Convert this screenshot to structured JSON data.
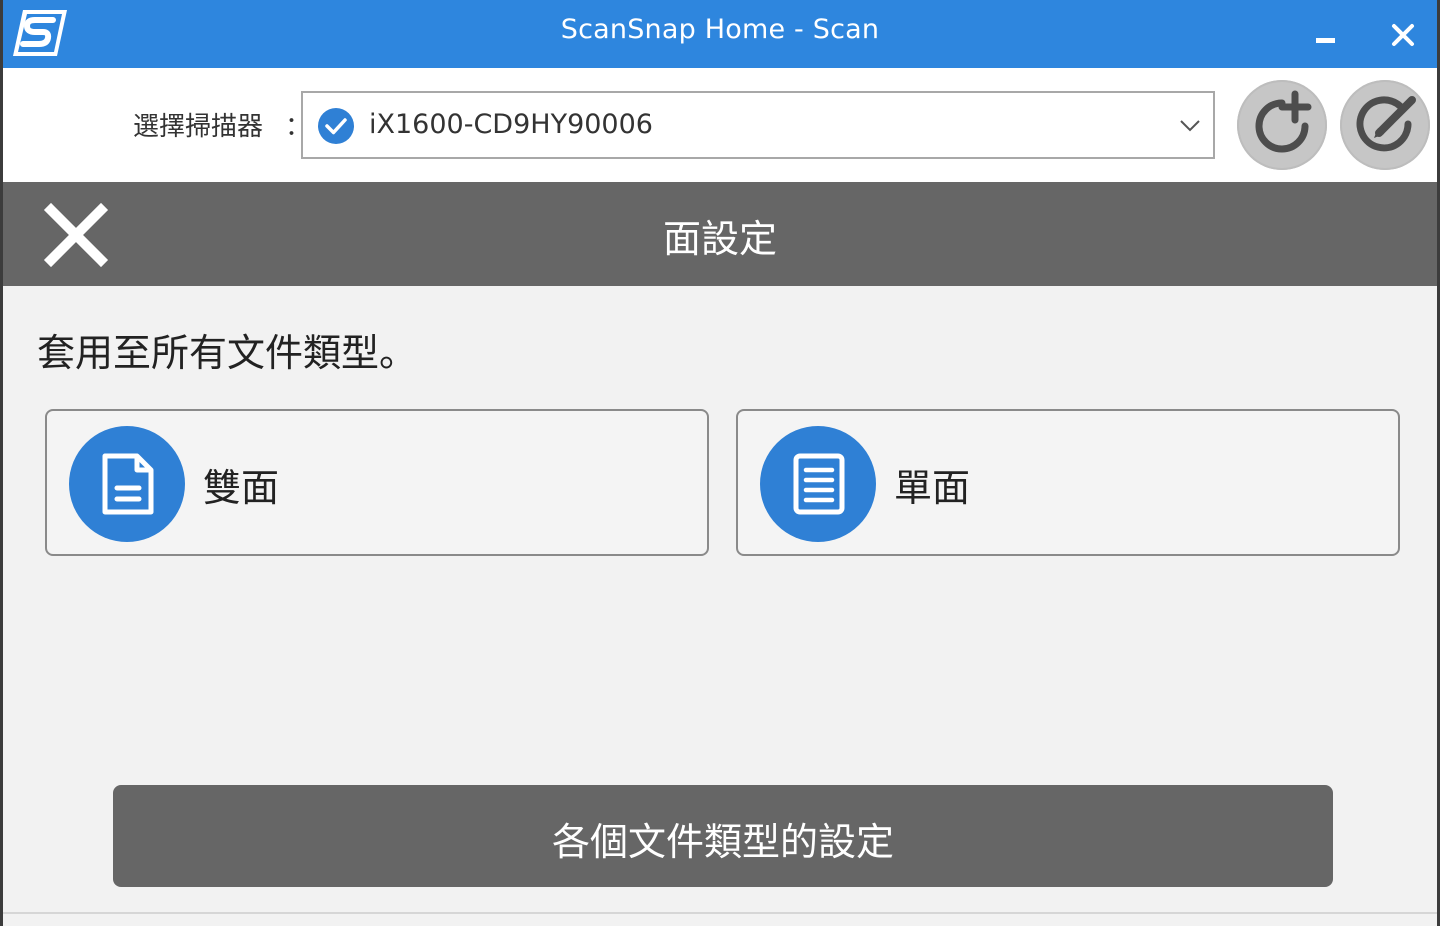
{
  "window": {
    "title": "ScanSnap Home - Scan",
    "accent_color": "#2e86de"
  },
  "titlebar": {
    "logo_icon": "scansnap-logo-icon",
    "minimize_icon": "minimize-icon",
    "close_icon": "close-icon"
  },
  "scanner_selector": {
    "label": "選擇掃描器",
    "colon": "：",
    "selected_value": "iX1600-CD9HY90006",
    "status_icon": "check-circle-icon",
    "dropdown_icon": "chevron-down-icon",
    "add_button_icon": "add-profile-icon",
    "edit_button_icon": "edit-profile-icon"
  },
  "panel": {
    "title": "面設定",
    "close_icon": "close-icon",
    "header_color": "#666666"
  },
  "content": {
    "instruction": "套用至所有文件類型。",
    "options": [
      {
        "label": "雙面",
        "icon": "duplex-document-icon"
      },
      {
        "label": "單面",
        "icon": "simplex-document-icon"
      }
    ],
    "per_type_button_label": "各個文件類型的設定"
  }
}
